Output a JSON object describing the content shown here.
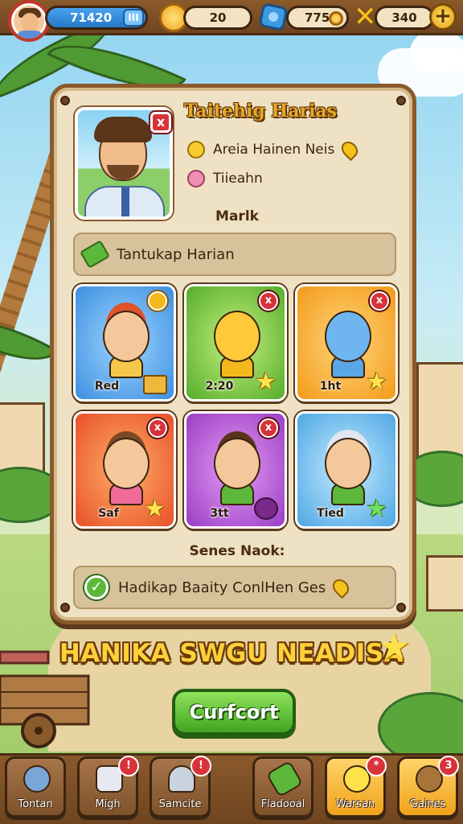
{
  "top_bar": {
    "gems": "71420",
    "coins": "20",
    "gear_value": "775",
    "energy": "340",
    "plus_label": "+",
    "menu_label": "III"
  },
  "panel": {
    "title": "Taitehig Harias",
    "info_line_1": "Areia Hainen Neis",
    "info_line_2": "Tiieahn",
    "section_label": "Marlk",
    "banner_text": "Tantukap Harian",
    "cards": [
      {
        "name": "Red",
        "color": "#3d8fe0"
      },
      {
        "name": "2:20",
        "color": "#55ad2c"
      },
      {
        "name": "1ht",
        "color": "#f39a1a"
      },
      {
        "name": "Saf",
        "color": "#e8502a"
      },
      {
        "name": "3tt",
        "color": "#9a3ec4"
      },
      {
        "name": "Tied",
        "color": "#4ea7e4"
      }
    ],
    "senes_label": "Senes Naok:",
    "quest_text": "Hadikap Baaity ConlHen Ges"
  },
  "big_title": "HANIKA SWGU NEADISA",
  "confirm_label": "Curfcort",
  "bottom_nav": [
    {
      "label": "Tontan",
      "badge": ""
    },
    {
      "label": "Migh",
      "badge": "!"
    },
    {
      "label": "Samcite",
      "badge": "!"
    },
    {
      "label": "Fladooal",
      "badge": ""
    },
    {
      "label": "Warsan",
      "badge": "*"
    },
    {
      "label": "Gaines",
      "badge": "3"
    }
  ],
  "icons": {
    "close": "close-icon",
    "badge_close": "x"
  }
}
